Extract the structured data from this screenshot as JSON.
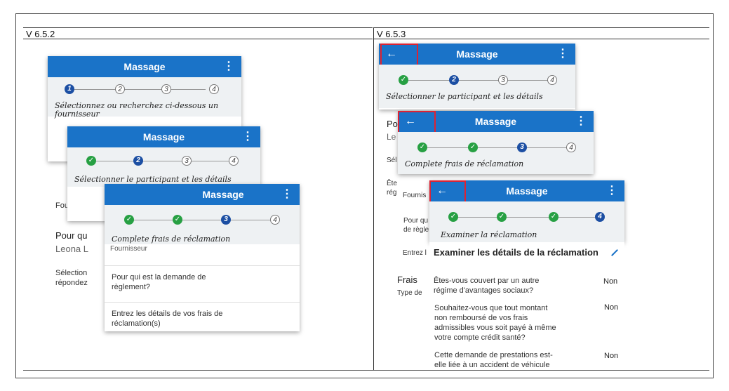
{
  "versions": {
    "left": "V 6.5.2",
    "right": "V 6.5.3"
  },
  "app": {
    "title": "Massage",
    "menu_icon": "⋮",
    "back_icon": "←",
    "accent": "#1a73c8",
    "done": "#27a043",
    "active": "#1c4fa3",
    "highlight": "#dd2233"
  },
  "steps": {
    "s1": "1",
    "s2": "2",
    "s3": "3",
    "s4": "4"
  },
  "left": {
    "step1_text": "Sélectionnez ou recherchez ci-dessous un fournisseur",
    "step2_text": "Sélectionner le participant et les détails",
    "step3_text": "Complete frais de réclamation",
    "fournisseur_partial": "Fourniss",
    "fournisseur_label": "Fournisseur",
    "pour_qui_partial": "Pour qu",
    "leona_partial": "Leona L",
    "selection_partial": "Sélection",
    "repondez_partial": "répondez",
    "pour_qui_full": "Pour qui est la demande de règlement?",
    "entrez_full": "Entrez les détails de vos frais de réclamation(s)"
  },
  "right": {
    "step2_text": "Sélectionner le participant et les détails",
    "step3_text": "Complete frais de réclamation",
    "step4_text": "Examiner la réclamation",
    "po_partial": "Po",
    "le_partial": "Le",
    "sel_partial": "Sél",
    "ete_partial": "Ête",
    "reg_partial": "rég",
    "fournis_partial": "Fournis",
    "pour_qu_partial": "Pour qu",
    "de_regle_partial": "de règle",
    "entrez_partial": "Entrez l",
    "frais_partial": "Frais",
    "type_partial": "Type de",
    "review_heading": "Examiner les détails de la réclamation",
    "edit_icon": "pencil-icon",
    "q1": "Êtes-vous couvert par un autre régime d'avantages sociaux?",
    "q1_answer": "Non",
    "q2": "Souhaitez-vous que tout montant non remboursé de vos frais admissibles vous soit payé à même votre compte crédit santé?",
    "q2_answer": "Non",
    "q3": "Cette demande de prestations est-elle liée à un accident de véhicule",
    "q3_answer": "Non"
  }
}
